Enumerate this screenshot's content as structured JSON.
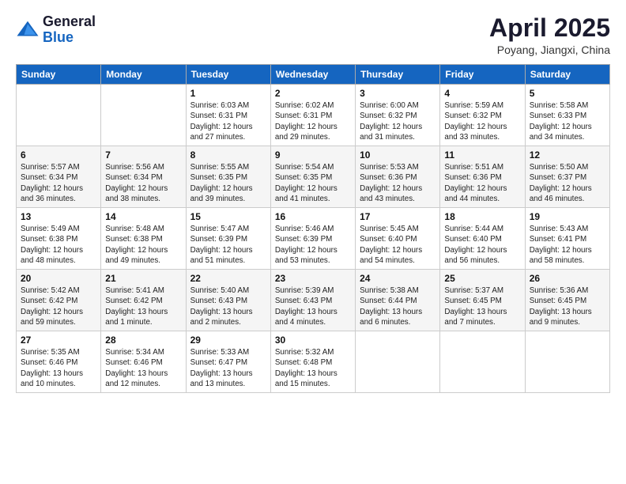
{
  "logo": {
    "general": "General",
    "blue": "Blue"
  },
  "header": {
    "month": "April 2025",
    "location": "Poyang, Jiangxi, China"
  },
  "weekdays": [
    "Sunday",
    "Monday",
    "Tuesday",
    "Wednesday",
    "Thursday",
    "Friday",
    "Saturday"
  ],
  "weeks": [
    [
      {
        "day": "",
        "info": ""
      },
      {
        "day": "",
        "info": ""
      },
      {
        "day": "1",
        "info": "Sunrise: 6:03 AM\nSunset: 6:31 PM\nDaylight: 12 hours and 27 minutes."
      },
      {
        "day": "2",
        "info": "Sunrise: 6:02 AM\nSunset: 6:31 PM\nDaylight: 12 hours and 29 minutes."
      },
      {
        "day": "3",
        "info": "Sunrise: 6:00 AM\nSunset: 6:32 PM\nDaylight: 12 hours and 31 minutes."
      },
      {
        "day": "4",
        "info": "Sunrise: 5:59 AM\nSunset: 6:32 PM\nDaylight: 12 hours and 33 minutes."
      },
      {
        "day": "5",
        "info": "Sunrise: 5:58 AM\nSunset: 6:33 PM\nDaylight: 12 hours and 34 minutes."
      }
    ],
    [
      {
        "day": "6",
        "info": "Sunrise: 5:57 AM\nSunset: 6:34 PM\nDaylight: 12 hours and 36 minutes."
      },
      {
        "day": "7",
        "info": "Sunrise: 5:56 AM\nSunset: 6:34 PM\nDaylight: 12 hours and 38 minutes."
      },
      {
        "day": "8",
        "info": "Sunrise: 5:55 AM\nSunset: 6:35 PM\nDaylight: 12 hours and 39 minutes."
      },
      {
        "day": "9",
        "info": "Sunrise: 5:54 AM\nSunset: 6:35 PM\nDaylight: 12 hours and 41 minutes."
      },
      {
        "day": "10",
        "info": "Sunrise: 5:53 AM\nSunset: 6:36 PM\nDaylight: 12 hours and 43 minutes."
      },
      {
        "day": "11",
        "info": "Sunrise: 5:51 AM\nSunset: 6:36 PM\nDaylight: 12 hours and 44 minutes."
      },
      {
        "day": "12",
        "info": "Sunrise: 5:50 AM\nSunset: 6:37 PM\nDaylight: 12 hours and 46 minutes."
      }
    ],
    [
      {
        "day": "13",
        "info": "Sunrise: 5:49 AM\nSunset: 6:38 PM\nDaylight: 12 hours and 48 minutes."
      },
      {
        "day": "14",
        "info": "Sunrise: 5:48 AM\nSunset: 6:38 PM\nDaylight: 12 hours and 49 minutes."
      },
      {
        "day": "15",
        "info": "Sunrise: 5:47 AM\nSunset: 6:39 PM\nDaylight: 12 hours and 51 minutes."
      },
      {
        "day": "16",
        "info": "Sunrise: 5:46 AM\nSunset: 6:39 PM\nDaylight: 12 hours and 53 minutes."
      },
      {
        "day": "17",
        "info": "Sunrise: 5:45 AM\nSunset: 6:40 PM\nDaylight: 12 hours and 54 minutes."
      },
      {
        "day": "18",
        "info": "Sunrise: 5:44 AM\nSunset: 6:40 PM\nDaylight: 12 hours and 56 minutes."
      },
      {
        "day": "19",
        "info": "Sunrise: 5:43 AM\nSunset: 6:41 PM\nDaylight: 12 hours and 58 minutes."
      }
    ],
    [
      {
        "day": "20",
        "info": "Sunrise: 5:42 AM\nSunset: 6:42 PM\nDaylight: 12 hours and 59 minutes."
      },
      {
        "day": "21",
        "info": "Sunrise: 5:41 AM\nSunset: 6:42 PM\nDaylight: 13 hours and 1 minute."
      },
      {
        "day": "22",
        "info": "Sunrise: 5:40 AM\nSunset: 6:43 PM\nDaylight: 13 hours and 2 minutes."
      },
      {
        "day": "23",
        "info": "Sunrise: 5:39 AM\nSunset: 6:43 PM\nDaylight: 13 hours and 4 minutes."
      },
      {
        "day": "24",
        "info": "Sunrise: 5:38 AM\nSunset: 6:44 PM\nDaylight: 13 hours and 6 minutes."
      },
      {
        "day": "25",
        "info": "Sunrise: 5:37 AM\nSunset: 6:45 PM\nDaylight: 13 hours and 7 minutes."
      },
      {
        "day": "26",
        "info": "Sunrise: 5:36 AM\nSunset: 6:45 PM\nDaylight: 13 hours and 9 minutes."
      }
    ],
    [
      {
        "day": "27",
        "info": "Sunrise: 5:35 AM\nSunset: 6:46 PM\nDaylight: 13 hours and 10 minutes."
      },
      {
        "day": "28",
        "info": "Sunrise: 5:34 AM\nSunset: 6:46 PM\nDaylight: 13 hours and 12 minutes."
      },
      {
        "day": "29",
        "info": "Sunrise: 5:33 AM\nSunset: 6:47 PM\nDaylight: 13 hours and 13 minutes."
      },
      {
        "day": "30",
        "info": "Sunrise: 5:32 AM\nSunset: 6:48 PM\nDaylight: 13 hours and 15 minutes."
      },
      {
        "day": "",
        "info": ""
      },
      {
        "day": "",
        "info": ""
      },
      {
        "day": "",
        "info": ""
      }
    ]
  ]
}
